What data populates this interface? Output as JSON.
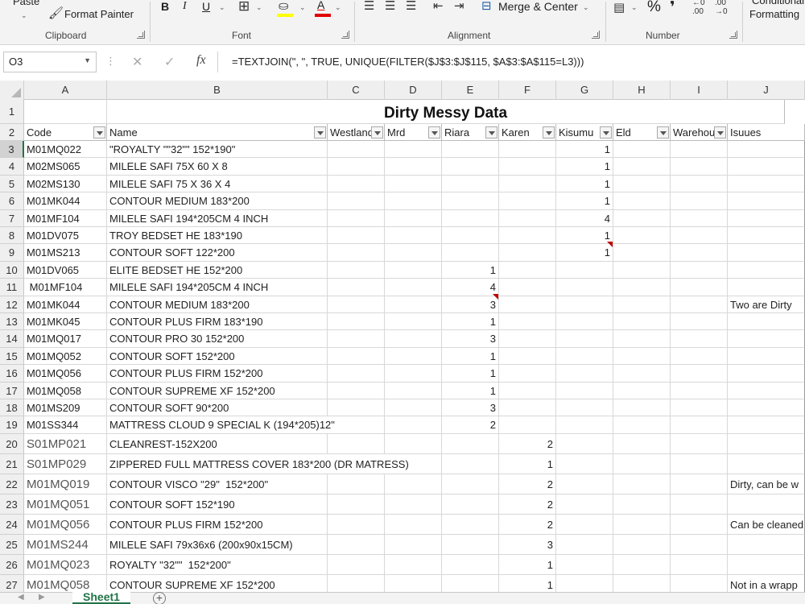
{
  "ribbon": {
    "paste_label": "Paste",
    "format_painter_label": "Format Painter",
    "merge_center_label": "Merge & Center",
    "conditional_label": "Conditional",
    "formatting_label": "Formatting",
    "percent_symbol": "%",
    "comma_symbol": "❜",
    "groups": {
      "clipboard": "Clipboard",
      "font": "Font",
      "alignment": "Alignment",
      "number": "Number"
    }
  },
  "formula_bar": {
    "cell_ref": "O3",
    "cancel_symbol": "✕",
    "enter_symbol": "✓",
    "fx_symbol": "fx",
    "formula": "=TEXTJOIN(\", \", TRUE, UNIQUE(FILTER($J$3:$J$115, $A$3:$A$115=L3)))"
  },
  "grid": {
    "selected_cell": "O3",
    "columns": [
      "A",
      "B",
      "C",
      "D",
      "E",
      "F",
      "G",
      "H",
      "I",
      "J"
    ],
    "title": "Dirty Messy Data",
    "headers": [
      "Code",
      "Name",
      "Westlands",
      "Mrd",
      "Riara",
      "Karen",
      "Kisumu",
      "Eld",
      "Warehouse",
      "Isuues"
    ],
    "rows": [
      {
        "n": "3",
        "code": "M01MQ022",
        "name": "\"ROYALTY \"\"32\"\" 152*190\"",
        "col": "G",
        "qty": "1"
      },
      {
        "n": "4",
        "code": "M02MS065",
        "name": "MILELE SAFI 75X 60 X 8",
        "col": "G",
        "qty": "1"
      },
      {
        "n": "5",
        "code": "M02MS130",
        "name": "MILELE SAFI 75 X 36 X 4",
        "col": "G",
        "qty": "1"
      },
      {
        "n": "6",
        "code": "M01MK044",
        "name": "CONTOUR MEDIUM 183*200",
        "col": "G",
        "qty": "1"
      },
      {
        "n": "7",
        "code": "M01MF104",
        "name": "MILELE SAFI 194*205CM 4 INCH",
        "col": "G",
        "qty": "4"
      },
      {
        "n": "8",
        "code": "M01DV075",
        "name": "TROY BEDSET HE 183*190",
        "col": "G",
        "qty": "1"
      },
      {
        "n": "9",
        "code": "M01MS213",
        "name": "CONTOUR SOFT 122*200",
        "col": "G",
        "qty": "1"
      },
      {
        "n": "10",
        "code": "M01DV065",
        "name": "ELITE BEDSET HE 152*200",
        "col": "E",
        "qty": "1"
      },
      {
        "n": "11",
        "code": " M01MF104",
        "name": "MILELE SAFI 194*205CM 4 INCH",
        "col": "E",
        "qty": "4"
      },
      {
        "n": "12",
        "code": "M01MK044",
        "name": "CONTOUR MEDIUM 183*200",
        "col": "E",
        "qty": "3",
        "issue": "Two are Dirty"
      },
      {
        "n": "13",
        "code": "M01MK045",
        "name": "CONTOUR PLUS FIRM 183*190",
        "col": "E",
        "qty": "1"
      },
      {
        "n": "14",
        "code": "M01MQ017",
        "name": "CONTOUR PRO 30 152*200",
        "col": "E",
        "qty": "3"
      },
      {
        "n": "15",
        "code": "M01MQ052",
        "name": "CONTOUR SOFT 152*200",
        "col": "E",
        "qty": "1"
      },
      {
        "n": "16",
        "code": "M01MQ056",
        "name": "CONTOUR PLUS FIRM 152*200",
        "col": "E",
        "qty": "1"
      },
      {
        "n": "17",
        "code": "M01MQ058",
        "name": "CONTOUR SUPREME XF 152*200",
        "col": "E",
        "qty": "1"
      },
      {
        "n": "18",
        "code": "M01MS209",
        "name": "CONTOUR SOFT 90*200",
        "col": "E",
        "qty": "3"
      },
      {
        "n": "19",
        "code": "M01SS344",
        "name": "MATTRESS CLOUD 9 SPECIAL K (194*205)12\"",
        "col": "E",
        "qty": "2"
      },
      {
        "n": "20",
        "code": "S01MP021",
        "name": "CLEANREST-152X200",
        "col": "F",
        "qty": "2"
      },
      {
        "n": "21",
        "code": "S01MP029",
        "name": "ZIPPERED FULL MATTRESS COVER 183*200 (DR MATRESS)",
        "col": "F",
        "qty": "1"
      },
      {
        "n": "22",
        "code": "M01MQ019",
        "name": "CONTOUR VISCO \"29\"  152*200\"",
        "col": "F",
        "qty": "2",
        "issue": "Dirty, can be w"
      },
      {
        "n": "23",
        "code": "M01MQ051",
        "name": "CONTOUR SOFT 152*190",
        "col": "F",
        "qty": "2"
      },
      {
        "n": "24",
        "code": "M01MQ056",
        "name": "CONTOUR PLUS FIRM 152*200",
        "col": "F",
        "qty": "2",
        "issue": "Can be cleaned"
      },
      {
        "n": "25",
        "code": "M01MS244",
        "name": "MILELE SAFI 79x36x6 (200x90x15CM)",
        "col": "F",
        "qty": "3"
      },
      {
        "n": "26",
        "code": "M01MQ023",
        "name": "ROYALTY \"32\"\"  152*200\"",
        "col": "F",
        "qty": "1"
      },
      {
        "n": "27",
        "code": "M01MQ058",
        "name": "CONTOUR SUPREME XF 152*200",
        "col": "F",
        "qty": "1",
        "issue": "Not in a wrapp"
      }
    ]
  },
  "sheets": {
    "active": "Sheet1",
    "add_symbol": "+"
  }
}
